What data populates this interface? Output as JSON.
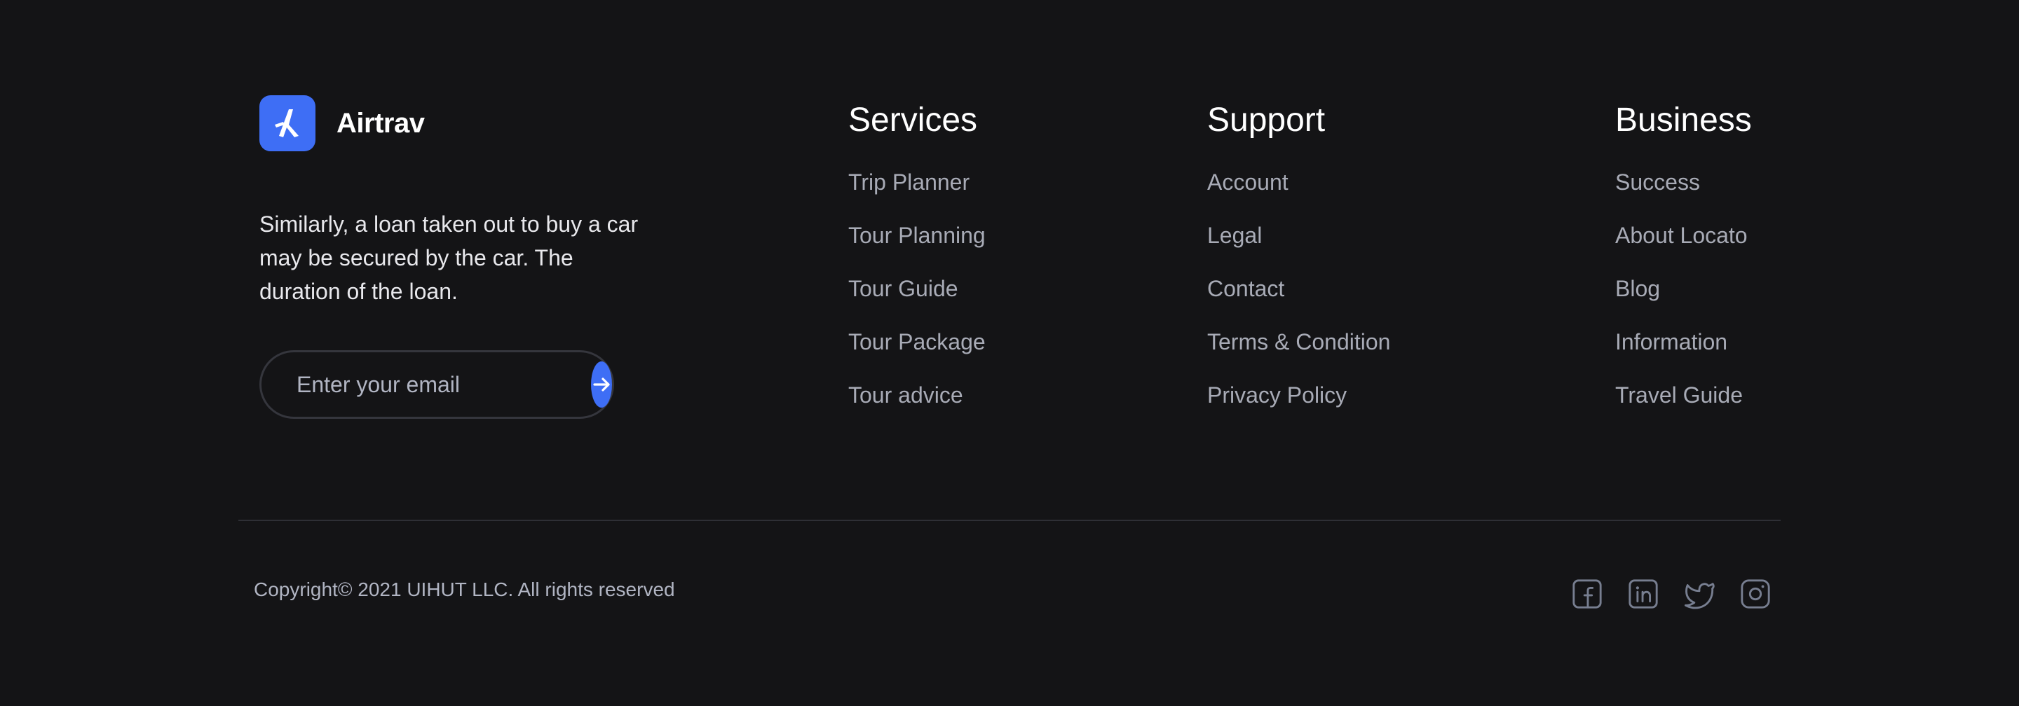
{
  "brand": {
    "name": "Airtrav",
    "logo_icon": "plane-icon",
    "accent": "#3E6EF5",
    "tagline": "Similarly, a loan taken out to buy a car may be secured by the car. The duration of the loan."
  },
  "subscribe": {
    "placeholder": "Enter your email",
    "submit_icon": "arrow-right-icon"
  },
  "columns": [
    {
      "title": "Services",
      "links": [
        "Trip Planner",
        "Tour Planning",
        "Tour Guide",
        "Tour Package",
        "Tour advice"
      ]
    },
    {
      "title": "Support",
      "links": [
        "Account",
        "Legal",
        "Contact",
        "Terms & Condition",
        "Privacy Policy"
      ]
    },
    {
      "title": "Business",
      "links": [
        "Success",
        "About Locato",
        "Blog",
        "Information",
        "Travel Guide"
      ]
    }
  ],
  "footer": {
    "copyright": "Copyright© 2021 UIHUT LLC. All rights reserved",
    "socials": [
      "facebook-icon",
      "linkedin-icon",
      "twitter-icon",
      "instagram-icon"
    ]
  },
  "colors": {
    "background": "#141416",
    "link": "#A8ABB6",
    "muted": "#B1B5C3",
    "icon": "#777E90"
  }
}
